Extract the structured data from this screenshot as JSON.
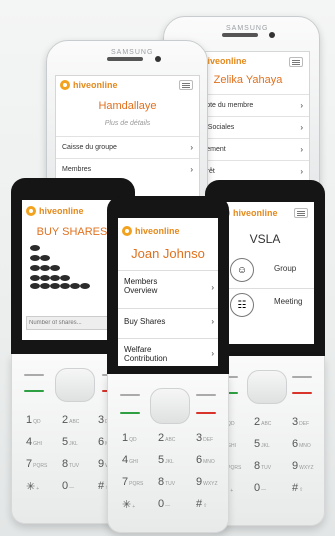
{
  "brand": {
    "logo_text": "hiveonline"
  },
  "phones": {
    "smartphone_right": {
      "maker": "SAMSUNG",
      "title": "Zelika Yahaya",
      "items": [
        {
          "label": "compte du membre"
        },
        {
          "label": "ions Sociales"
        },
        {
          "label": "versement"
        },
        {
          "label": "un prêt"
        }
      ]
    },
    "smartphone_left": {
      "maker": "SAMSUNG",
      "title": "Hamdallaye",
      "subtitle": "Plus de détails",
      "items": [
        {
          "label": "Caisse du groupe"
        },
        {
          "label": "Membres"
        }
      ]
    },
    "feature_left": {
      "title": "BUY SHARES",
      "input_placeholder": "Number of shares..."
    },
    "feature_middle": {
      "title": "Joan Johnso",
      "items": [
        {
          "label_line1": "Members",
          "label_line2": "Overview"
        },
        {
          "label_line1": "Buy Shares",
          "label_line2": ""
        },
        {
          "label_line1": "Welfare",
          "label_line2": "Contribution"
        }
      ]
    },
    "feature_right": {
      "title": "VSLA",
      "buttons": [
        {
          "label": "Group",
          "icon": "group-icon"
        },
        {
          "label": "Meeting",
          "icon": "meeting-icon"
        }
      ]
    }
  },
  "keypad": {
    "rows": [
      [
        {
          "d": "1",
          "l": "QD"
        },
        {
          "d": "2",
          "l": "ABC"
        },
        {
          "d": "3",
          "l": "DEF"
        }
      ],
      [
        {
          "d": "4",
          "l": "GHI"
        },
        {
          "d": "5",
          "l": "JKL"
        },
        {
          "d": "6",
          "l": "MNO"
        }
      ],
      [
        {
          "d": "7",
          "l": "PQRS"
        },
        {
          "d": "8",
          "l": "TUV"
        },
        {
          "d": "9",
          "l": "WXYZ"
        }
      ],
      [
        {
          "d": "✳",
          "l": "+"
        },
        {
          "d": "0",
          "l": "—"
        },
        {
          "d": "#",
          "l": "⇧"
        }
      ]
    ]
  },
  "colors": {
    "accent": "#e0711f",
    "call_green": "#2ea043",
    "end_red": "#d9342b"
  }
}
